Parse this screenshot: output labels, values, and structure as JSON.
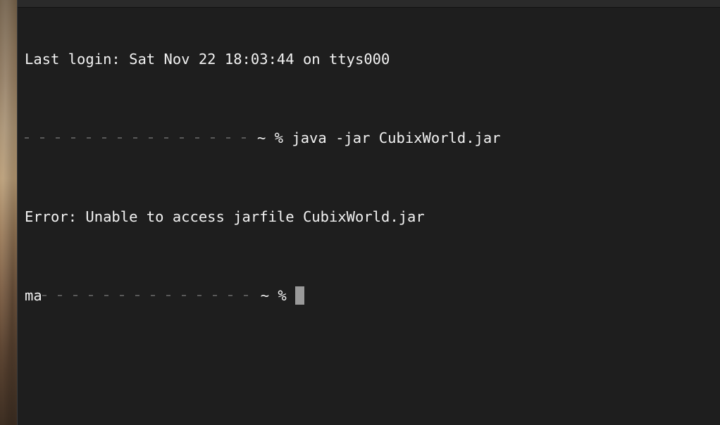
{
  "terminal": {
    "last_login": "Last login: Sat Nov 22 18:03:44 on ttys000",
    "line2": {
      "prompt_start": "",
      "prompt_suffix": "~ %",
      "command": "java -jar CubixWorld.jar"
    },
    "error": "Error: Unable to access jarfile CubixWorld.jar",
    "line4": {
      "prompt_start": "ma",
      "prompt_suffix": "~ %"
    }
  },
  "colors": {
    "background": "#1e1e1e",
    "text": "#f2f2f2",
    "cursor": "#9a9a9a"
  }
}
